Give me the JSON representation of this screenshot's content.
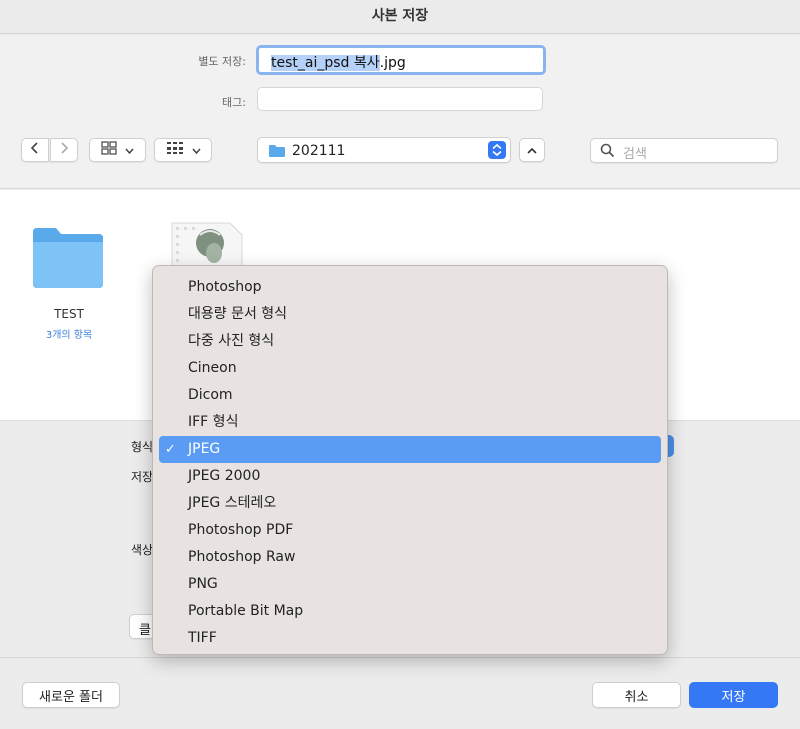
{
  "window": {
    "title": "사본 저장"
  },
  "save_as": {
    "label": "별도 저장:",
    "filename_selected": "test_ai_psd 복사",
    "filename_ext": ".jpg"
  },
  "tags": {
    "label": "태그:",
    "value": ""
  },
  "toolbar": {
    "back_icon": "chevron-left-icon",
    "forward_icon": "chevron-right-icon",
    "location": "202111",
    "search_placeholder": "검색"
  },
  "files": [
    {
      "name": "TEST",
      "sub": "3개의 항목",
      "kind": "folder"
    },
    {
      "name": "",
      "sub": "",
      "kind": "image"
    }
  ],
  "options": {
    "format_label": "형식",
    "save_label": "저장",
    "color_label": "색상",
    "cloud_button": "클"
  },
  "format_menu": {
    "items": [
      "Photoshop",
      "대용량 문서 형식",
      "다중 사진 형식",
      "Cineon",
      "Dicom",
      "IFF 형식",
      "JPEG",
      "JPEG 2000",
      "JPEG 스테레오",
      "Photoshop PDF",
      "Photoshop Raw",
      "PNG",
      "Portable Bit Map",
      "TIFF"
    ],
    "selected": "JPEG"
  },
  "bottom": {
    "new_folder": "새로운 폴더",
    "cancel": "취소",
    "save": "저장"
  },
  "colors": {
    "accent": "#3478f6",
    "menu_highlight": "#5a9cf3",
    "folder": "#5aa9ea"
  }
}
